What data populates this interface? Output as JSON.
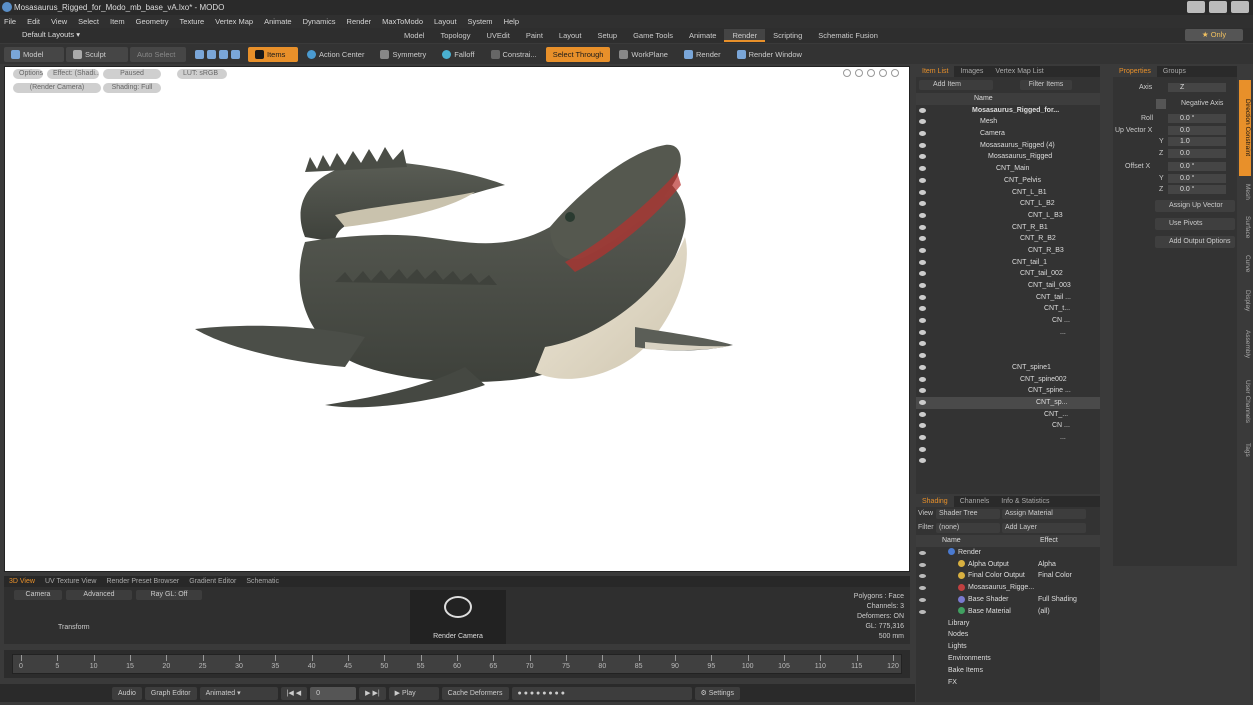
{
  "window": {
    "title": "Mosasaurus_Rigged_for_Modo_mb_base_vA.lxo* - MODO"
  },
  "menu": [
    "File",
    "Edit",
    "View",
    "Select",
    "Item",
    "Geometry",
    "Texture",
    "Vertex Map",
    "Animate",
    "Dynamics",
    "Render",
    "MaxToModo",
    "Layout",
    "System",
    "Help"
  ],
  "layout_selector": "Default Layouts",
  "mode_tabs": [
    "Model",
    "Topology",
    "UVEdit",
    "Paint",
    "Layout",
    "Setup",
    "Game Tools",
    "Animate",
    "Render",
    "Scripting",
    "Schematic Fusion"
  ],
  "active_mode_tab": "Render",
  "only_button": "Only",
  "toolbar": {
    "model": "Model",
    "sculpt": "Sculpt",
    "auto_select": "Auto Select",
    "items": "Items",
    "action_center": "Action Center",
    "symmetry": "Symmetry",
    "falloff": "Falloff",
    "constrain": "Constrai...",
    "select_through": "Select Through",
    "workplane": "WorkPlane",
    "render": "Render",
    "render_window": "Render Window"
  },
  "viewport": {
    "chips": [
      "Options",
      "Effect: (Shadi...",
      "Paused",
      "LUT: sRGB",
      "(Render Camera)",
      "Shading: Full"
    ]
  },
  "lower_tabs": [
    "3D View",
    "UV Texture View",
    "Render Preset Browser",
    "Gradient Editor",
    "Schematic"
  ],
  "lower_buttons": {
    "camera": "Camera",
    "advanced": "Advanced",
    "raygl": "Ray GL: Off",
    "transform": "Transform",
    "render_camera": "Render Camera"
  },
  "stats": [
    "Polygons : Face",
    "Channels: 3",
    "Deformers: ON",
    "GL: 775,316",
    "500 mm"
  ],
  "timeline": {
    "ticks": [
      0,
      5,
      10,
      15,
      20,
      25,
      30,
      35,
      40,
      45,
      50,
      55,
      60,
      65,
      70,
      75,
      80,
      85,
      90,
      95,
      100,
      105,
      110,
      115,
      120
    ],
    "start": "0",
    "mid": "120",
    "end": "120"
  },
  "bottom": {
    "audio": "Audio",
    "graph_editor": "Graph Editor",
    "animated": "Animated",
    "frame": "0",
    "play": "Play",
    "cache": "Cache Deformers",
    "settings": "Settings"
  },
  "item_list": {
    "tabs": [
      "Item List",
      "Images",
      "Vertex Map List"
    ],
    "add_item": "Add Item",
    "filter_items": "Filter Items",
    "header": "Name",
    "rows": [
      {
        "indent": 0,
        "label": "Mosasaurus_Rigged_for..."
      },
      {
        "indent": 1,
        "label": "Mesh"
      },
      {
        "indent": 1,
        "label": "Camera"
      },
      {
        "indent": 1,
        "label": "Mosasaurus_Rigged (4)"
      },
      {
        "indent": 2,
        "label": "Mosasaurus_Rigged"
      },
      {
        "indent": 3,
        "label": "CNT_Main"
      },
      {
        "indent": 4,
        "label": "CNT_Pelvis"
      },
      {
        "indent": 5,
        "label": "CNT_L_B1"
      },
      {
        "indent": 6,
        "label": "CNT_L_B2"
      },
      {
        "indent": 7,
        "label": "CNT_L_B3"
      },
      {
        "indent": 5,
        "label": "CNT_R_B1"
      },
      {
        "indent": 6,
        "label": "CNT_R_B2"
      },
      {
        "indent": 7,
        "label": "CNT_R_B3"
      },
      {
        "indent": 5,
        "label": "CNT_tail_1"
      },
      {
        "indent": 6,
        "label": "CNT_tail_002"
      },
      {
        "indent": 7,
        "label": "CNT_tail_003"
      },
      {
        "indent": 8,
        "label": "CNT_tail ..."
      },
      {
        "indent": 9,
        "label": "CNT_t..."
      },
      {
        "indent": 10,
        "label": "CN ..."
      },
      {
        "indent": 11,
        "label": "..."
      },
      {
        "indent": 12,
        "label": ""
      },
      {
        "indent": 12,
        "label": ""
      },
      {
        "indent": 5,
        "label": "CNT_spine1"
      },
      {
        "indent": 6,
        "label": "CNT_spine002"
      },
      {
        "indent": 7,
        "label": "CNT_spine ..."
      },
      {
        "indent": 8,
        "label": "CNT_sp..."
      },
      {
        "indent": 9,
        "label": "CNT_..."
      },
      {
        "indent": 10,
        "label": "CN ..."
      },
      {
        "indent": 11,
        "label": "..."
      },
      {
        "indent": 12,
        "label": ""
      },
      {
        "indent": 12,
        "label": ""
      }
    ]
  },
  "properties": {
    "tabs": [
      "Properties",
      "Groups"
    ],
    "axis_label": "Axis",
    "axis_value": "Z",
    "negative_axis": "Negative Axis",
    "roll_label": "Roll",
    "roll_value": "0.0 °",
    "up_vector_label": "Up Vector X",
    "up_x": "0.0",
    "y_label": "Y",
    "up_y": "1.0",
    "z_label": "Z",
    "up_z": "0.0",
    "offset_label": "Offset X",
    "off_x": "0.0 °",
    "off_y": "0.0 °",
    "off_z": "0.0 °",
    "assign_up": "Assign Up Vector",
    "use_pivots": "Use Pivots",
    "add_output": "Add Output Options"
  },
  "vertical_tabs": [
    "Direction Constraint",
    "Mesh",
    "Surface",
    "Curve",
    "Display",
    "Assembly",
    "User Channels",
    "Tags"
  ],
  "shading": {
    "tabs": [
      "Shading",
      "Channels",
      "Info & Statistics"
    ],
    "view_label": "View",
    "view_value": "Shader Tree",
    "assign_material": "Assign Material",
    "filter_label": "Filter",
    "filter_value": "(none)",
    "add_layer": "Add Layer",
    "col_name": "Name",
    "col_effect": "Effect",
    "rows": [
      {
        "name": "Render",
        "effect": "",
        "color": "#4a7ad0",
        "indent": 0
      },
      {
        "name": "Alpha Output",
        "effect": "Alpha",
        "color": "#d8b040",
        "indent": 1
      },
      {
        "name": "Final Color Output",
        "effect": "Final Color",
        "color": "#d8b040",
        "indent": 1
      },
      {
        "name": "Mosasaurus_Rigge...",
        "effect": "",
        "color": "#c04040",
        "indent": 1
      },
      {
        "name": "Base Shader",
        "effect": "Full Shading",
        "color": "#7a7ad0",
        "indent": 1
      },
      {
        "name": "Base Material",
        "effect": "(all)",
        "color": "#40a060",
        "indent": 1
      },
      {
        "name": "Library",
        "effect": "",
        "color": "",
        "indent": 0
      },
      {
        "name": "Nodes",
        "effect": "",
        "color": "",
        "indent": 0
      },
      {
        "name": "Lights",
        "effect": "",
        "color": "",
        "indent": 0
      },
      {
        "name": "Environments",
        "effect": "",
        "color": "",
        "indent": 0
      },
      {
        "name": "Bake Items",
        "effect": "",
        "color": "",
        "indent": 0
      },
      {
        "name": "FX",
        "effect": "",
        "color": "",
        "indent": 0
      }
    ]
  }
}
